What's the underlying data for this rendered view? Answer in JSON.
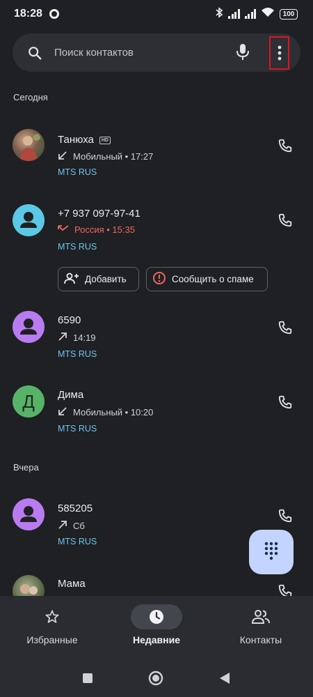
{
  "status_bar": {
    "time": "18:28",
    "battery": "100"
  },
  "search": {
    "placeholder": "Поиск контактов"
  },
  "sections": {
    "today": "Сегодня",
    "yesterday": "Вчера"
  },
  "calls": [
    {
      "name": "Танюха",
      "badge": "HD",
      "direction": "incoming",
      "meta": "Мобильный • 17:27",
      "carrier": "MTS RUS",
      "avatar": "photo"
    },
    {
      "name": "+7 937 097-97-41",
      "direction": "missed",
      "meta": "Россия • 15:35",
      "carrier": "MTS RUS",
      "avatar": "person-cyan"
    },
    {
      "name": "6590",
      "direction": "outgoing",
      "meta": "14:19",
      "carrier": "MTS RUS",
      "avatar": "person-purple"
    },
    {
      "name": "Дима",
      "direction": "incoming",
      "meta": "Мобильный • 10:20",
      "carrier": "MTS RUS",
      "avatar": "letter",
      "avatar_letter": "Д"
    },
    {
      "name": "585205",
      "direction": "outgoing",
      "meta": "Сб",
      "carrier": "MTS RUS",
      "avatar": "person-purple"
    },
    {
      "name": "Мама",
      "avatar": "photo"
    }
  ],
  "actions": {
    "add": "Добавить",
    "report_spam": "Сообщить о спаме"
  },
  "bottom_nav": [
    {
      "label": "Избранные",
      "icon": "star-icon",
      "active": false
    },
    {
      "label": "Недавние",
      "icon": "clock-icon",
      "active": true
    },
    {
      "label": "Контакты",
      "icon": "contacts-icon",
      "active": false
    }
  ],
  "colors": {
    "background": "#1f2024",
    "carrier": "#6ec3e9",
    "missed": "#ee675c",
    "fab": "#c3d4ff",
    "highlight": "#e0141b"
  }
}
